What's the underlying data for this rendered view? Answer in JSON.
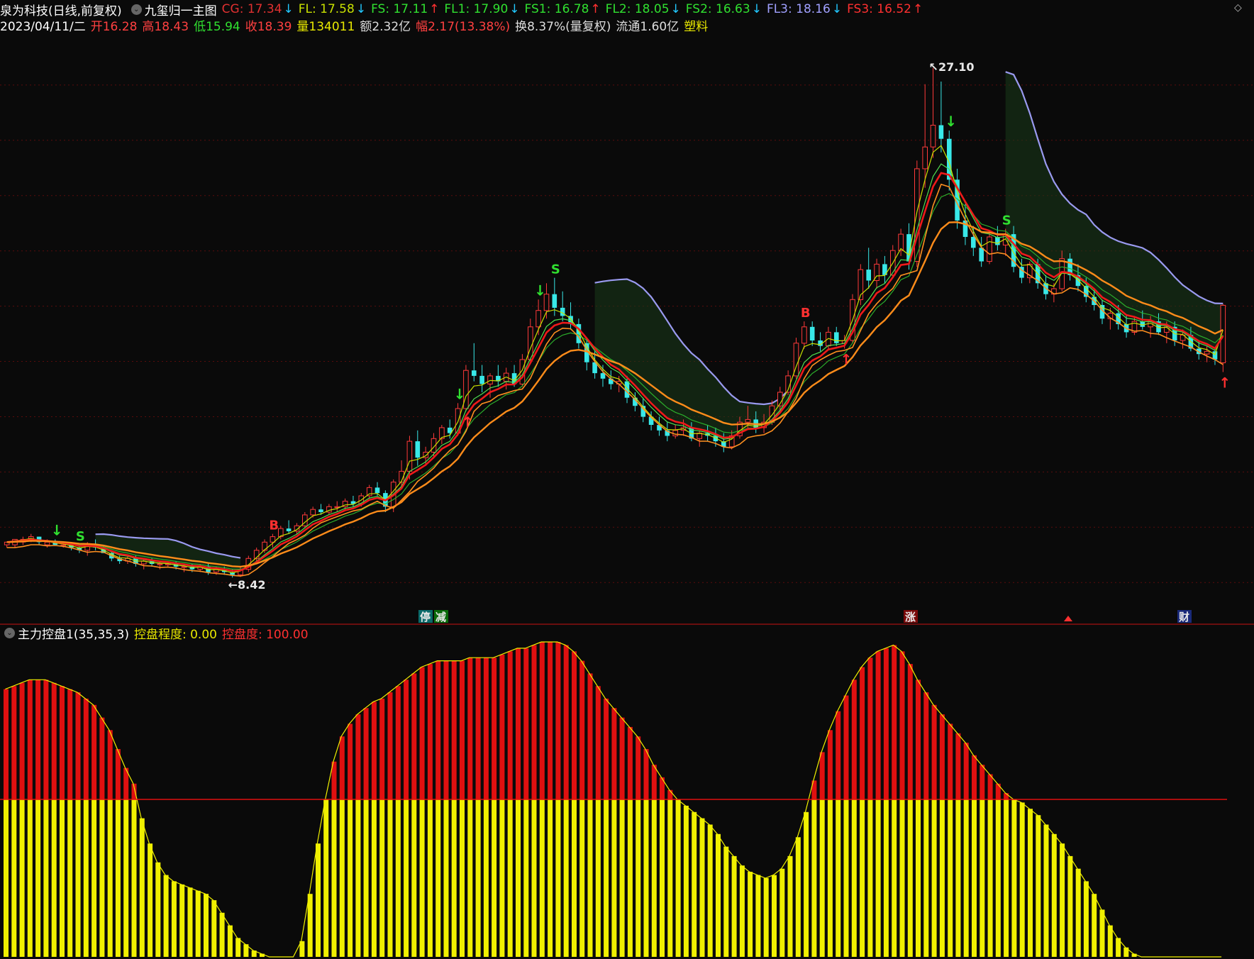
{
  "header": {
    "stock": "泉为科技(日线,前复权)",
    "template": "九玺归一主图",
    "indicators": [
      {
        "label": "CG: 17.34",
        "arrow": "↓",
        "color": "#e03030",
        "arrowColor": "#22c8ff"
      },
      {
        "label": "FL: 17.58",
        "arrow": "↓",
        "color": "#c8e000",
        "arrowColor": "#22c8ff"
      },
      {
        "label": "FS: 17.11",
        "arrow": "↑",
        "color": "#30e030",
        "arrowColor": "#ff3030"
      },
      {
        "label": "FL1: 17.90",
        "arrow": "↓",
        "color": "#30e030",
        "arrowColor": "#22c8ff"
      },
      {
        "label": "FS1: 16.78",
        "arrow": "↑",
        "color": "#30e030",
        "arrowColor": "#ff3030"
      },
      {
        "label": "FL2: 18.05",
        "arrow": "↓",
        "color": "#30e030",
        "arrowColor": "#22c8ff"
      },
      {
        "label": "FS2: 16.63",
        "arrow": "↓",
        "color": "#30e030",
        "arrowColor": "#22c8ff"
      },
      {
        "label": "FL3: 18.16",
        "arrow": "↓",
        "color": "#a0a0ff",
        "arrowColor": "#22c8ff"
      },
      {
        "label": "FS3: 16.52",
        "arrow": "↑",
        "color": "#ff3030",
        "arrowColor": "#ff3030"
      }
    ],
    "date": "2023/04/11/二",
    "stats": [
      {
        "k": "开",
        "v": "16.28",
        "kc": "#ff4040",
        "vc": "#ff4040"
      },
      {
        "k": "高",
        "v": "18.43",
        "kc": "#ff4040",
        "vc": "#ff4040"
      },
      {
        "k": "低",
        "v": "15.94",
        "kc": "#30e030",
        "vc": "#30e030"
      },
      {
        "k": "收",
        "v": "18.39",
        "kc": "#ff4040",
        "vc": "#ff4040"
      },
      {
        "k": "量",
        "v": "134011",
        "kc": "#e8e800",
        "vc": "#e8e800"
      },
      {
        "k": "额",
        "v": "2.32亿",
        "kc": "#ddd",
        "vc": "#ddd"
      },
      {
        "k": "幅",
        "v": "2.17(13.38%)",
        "kc": "#ff4040",
        "vc": "#ff4040"
      },
      {
        "k": "换",
        "v": "8.37%(量复权)",
        "kc": "#ddd",
        "vc": "#ddd"
      },
      {
        "k": "流通",
        "v": "1.60亿",
        "kc": "#ddd",
        "vc": "#ddd"
      },
      {
        "k": "",
        "v": "塑料",
        "kc": "#e8e800",
        "vc": "#e8e800"
      }
    ]
  },
  "sub": {
    "title": "主力控盘1(35,35,3)",
    "l1": "控盘程度: 0.00",
    "l2": "控盘度: 100.00"
  },
  "markers": {
    "b": "B",
    "s": "S",
    "ting": "停",
    "jian": "减",
    "zhang": "涨",
    "cai": "财"
  },
  "chart_data": [
    {
      "type": "candlestick",
      "ylim": [
        7.0,
        28.5
      ],
      "max_label": "27.10",
      "min_label": "8.42",
      "candles": [
        [
          9.6,
          9.7,
          9.5,
          9.7
        ],
        [
          9.6,
          9.8,
          9.5,
          9.8
        ],
        [
          9.7,
          9.9,
          9.6,
          9.8
        ],
        [
          9.8,
          10.0,
          9.7,
          9.9
        ],
        [
          9.9,
          9.9,
          9.6,
          9.7
        ],
        [
          9.6,
          9.8,
          9.5,
          9.7
        ],
        [
          9.7,
          9.8,
          9.6,
          9.6
        ],
        [
          9.6,
          9.7,
          9.5,
          9.6
        ],
        [
          9.6,
          9.7,
          9.4,
          9.5
        ],
        [
          9.5,
          9.6,
          9.3,
          9.4
        ],
        [
          9.4,
          9.7,
          9.2,
          9.6
        ],
        [
          9.6,
          9.8,
          9.4,
          9.5
        ],
        [
          9.5,
          9.6,
          9.3,
          9.3
        ],
        [
          9.3,
          9.4,
          9.0,
          9.1
        ],
        [
          9.1,
          9.2,
          8.9,
          9.0
        ],
        [
          9.0,
          9.2,
          8.9,
          9.1
        ],
        [
          9.1,
          9.2,
          8.8,
          8.9
        ],
        [
          8.9,
          9.1,
          8.7,
          9.0
        ],
        [
          9.0,
          9.1,
          8.8,
          8.9
        ],
        [
          8.9,
          9.0,
          8.7,
          8.9
        ],
        [
          8.9,
          9.0,
          8.8,
          8.9
        ],
        [
          8.9,
          9.0,
          8.7,
          8.8
        ],
        [
          8.8,
          8.9,
          8.6,
          8.8
        ],
        [
          8.8,
          8.9,
          8.6,
          8.7
        ],
        [
          8.7,
          8.9,
          8.6,
          8.8
        ],
        [
          8.8,
          8.9,
          8.5,
          8.6
        ],
        [
          8.6,
          8.8,
          8.5,
          8.7
        ],
        [
          8.7,
          8.8,
          8.5,
          8.6
        ],
        [
          8.6,
          8.7,
          8.4,
          8.5
        ],
        [
          8.5,
          8.8,
          8.42,
          8.7
        ],
        [
          8.7,
          9.2,
          8.6,
          9.1
        ],
        [
          9.1,
          9.5,
          9.0,
          9.4
        ],
        [
          9.4,
          9.8,
          9.3,
          9.7
        ],
        [
          9.7,
          10.0,
          9.5,
          9.9
        ],
        [
          9.9,
          10.3,
          9.8,
          10.2
        ],
        [
          10.2,
          10.5,
          10.0,
          10.1
        ],
        [
          10.1,
          10.4,
          10.0,
          10.3
        ],
        [
          10.3,
          10.8,
          10.2,
          10.7
        ],
        [
          10.7,
          11.0,
          10.6,
          10.9
        ],
        [
          10.9,
          11.1,
          10.7,
          10.8
        ],
        [
          10.8,
          11.1,
          10.7,
          11.0
        ],
        [
          11.0,
          11.2,
          10.8,
          11.0
        ],
        [
          11.0,
          11.3,
          10.9,
          11.2
        ],
        [
          11.2,
          11.4,
          11.0,
          11.1
        ],
        [
          11.1,
          11.5,
          11.0,
          11.4
        ],
        [
          11.4,
          11.8,
          11.3,
          11.7
        ],
        [
          11.7,
          11.9,
          11.4,
          11.5
        ],
        [
          11.5,
          11.6,
          10.8,
          11.0
        ],
        [
          11.0,
          12.0,
          10.8,
          11.9
        ],
        [
          11.9,
          12.7,
          11.7,
          12.3
        ],
        [
          12.3,
          13.6,
          12.0,
          13.4
        ],
        [
          13.4,
          13.8,
          12.5,
          12.8
        ],
        [
          12.8,
          13.2,
          12.5,
          13.0
        ],
        [
          13.0,
          13.7,
          12.8,
          13.5
        ],
        [
          13.5,
          14.0,
          13.3,
          13.9
        ],
        [
          13.9,
          14.2,
          13.5,
          13.7
        ],
        [
          13.7,
          14.8,
          13.6,
          14.6
        ],
        [
          14.6,
          16.2,
          14.5,
          16.0
        ],
        [
          16.0,
          17.0,
          15.6,
          15.8
        ],
        [
          15.8,
          16.2,
          15.2,
          15.5
        ],
        [
          15.5,
          15.9,
          15.0,
          15.8
        ],
        [
          15.8,
          16.2,
          15.4,
          15.6
        ],
        [
          15.6,
          16.1,
          15.3,
          15.9
        ],
        [
          15.9,
          16.2,
          15.4,
          15.5
        ],
        [
          15.5,
          16.6,
          15.4,
          16.4
        ],
        [
          16.4,
          17.9,
          16.3,
          17.6
        ],
        [
          17.6,
          18.6,
          17.3,
          18.2
        ],
        [
          18.2,
          19.2,
          17.9,
          18.8
        ],
        [
          18.8,
          19.4,
          18.0,
          18.3
        ],
        [
          18.3,
          18.9,
          17.8,
          18.0
        ],
        [
          18.0,
          18.5,
          17.5,
          17.7
        ],
        [
          17.7,
          17.9,
          16.8,
          17.0
        ],
        [
          17.0,
          17.2,
          16.0,
          16.3
        ],
        [
          16.3,
          16.7,
          15.7,
          15.9
        ],
        [
          15.9,
          16.2,
          15.4,
          15.7
        ],
        [
          15.7,
          16.0,
          15.3,
          15.5
        ],
        [
          15.5,
          15.8,
          15.2,
          15.6
        ],
        [
          15.6,
          15.8,
          14.8,
          15.0
        ],
        [
          15.0,
          15.2,
          14.5,
          14.7
        ],
        [
          14.7,
          15.0,
          14.1,
          14.3
        ],
        [
          14.3,
          14.5,
          13.8,
          14.0
        ],
        [
          14.0,
          14.3,
          13.6,
          13.8
        ],
        [
          13.8,
          14.1,
          13.4,
          13.6
        ],
        [
          13.6,
          14.0,
          13.5,
          13.8
        ],
        [
          13.8,
          14.2,
          13.6,
          13.9
        ],
        [
          13.9,
          14.1,
          13.4,
          13.5
        ],
        [
          13.5,
          13.8,
          13.2,
          13.7
        ],
        [
          13.7,
          14.0,
          13.4,
          13.6
        ],
        [
          13.6,
          13.9,
          13.2,
          13.4
        ],
        [
          13.4,
          13.7,
          13.0,
          13.2
        ],
        [
          13.2,
          13.8,
          13.1,
          13.6
        ],
        [
          13.6,
          14.3,
          13.5,
          14.1
        ],
        [
          14.1,
          14.7,
          13.9,
          14.2
        ],
        [
          14.2,
          14.5,
          13.7,
          13.9
        ],
        [
          13.9,
          14.4,
          13.7,
          14.1
        ],
        [
          14.1,
          14.9,
          14.0,
          14.7
        ],
        [
          14.7,
          15.4,
          14.5,
          15.2
        ],
        [
          15.2,
          16.0,
          15.1,
          15.8
        ],
        [
          15.8,
          17.2,
          15.7,
          17.0
        ],
        [
          17.0,
          17.8,
          16.8,
          17.6
        ],
        [
          17.6,
          17.8,
          16.9,
          17.1
        ],
        [
          17.1,
          17.4,
          16.7,
          16.9
        ],
        [
          16.9,
          17.6,
          16.8,
          17.4
        ],
        [
          17.4,
          17.6,
          16.9,
          17.0
        ],
        [
          17.0,
          17.3,
          16.8,
          17.1
        ],
        [
          17.1,
          18.8,
          17.0,
          18.6
        ],
        [
          18.6,
          19.9,
          18.4,
          19.7
        ],
        [
          19.7,
          20.5,
          19.0,
          19.3
        ],
        [
          19.3,
          20.1,
          19.0,
          19.9
        ],
        [
          19.9,
          20.2,
          19.2,
          19.5
        ],
        [
          19.5,
          20.6,
          19.4,
          20.4
        ],
        [
          20.4,
          21.2,
          20.2,
          21.0
        ],
        [
          21.0,
          21.4,
          19.7,
          20.0
        ],
        [
          20.0,
          23.7,
          19.8,
          23.4
        ],
        [
          23.4,
          26.5,
          22.7,
          24.2
        ],
        [
          24.2,
          27.1,
          23.8,
          25.0
        ],
        [
          25.0,
          26.6,
          24.0,
          24.5
        ],
        [
          24.5,
          24.8,
          22.6,
          23.0
        ],
        [
          23.0,
          23.4,
          21.2,
          21.5
        ],
        [
          21.5,
          22.1,
          20.6,
          20.9
        ],
        [
          20.9,
          21.3,
          20.2,
          20.5
        ],
        [
          20.5,
          20.9,
          19.8,
          20.0
        ],
        [
          20.0,
          21.1,
          19.9,
          20.9
        ],
        [
          20.9,
          21.3,
          20.4,
          20.6
        ],
        [
          20.6,
          21.2,
          20.2,
          21.0
        ],
        [
          21.0,
          21.3,
          19.6,
          19.8
        ],
        [
          19.8,
          20.1,
          19.2,
          19.4
        ],
        [
          19.4,
          20.0,
          19.2,
          19.9
        ],
        [
          19.9,
          20.1,
          19.0,
          19.2
        ],
        [
          19.2,
          19.5,
          18.6,
          18.8
        ],
        [
          18.8,
          19.2,
          18.5,
          19.0
        ],
        [
          19.0,
          20.4,
          18.9,
          20.1
        ],
        [
          20.1,
          20.3,
          19.3,
          19.5
        ],
        [
          19.5,
          19.9,
          18.9,
          19.1
        ],
        [
          19.1,
          19.4,
          18.5,
          18.7
        ],
        [
          18.7,
          19.0,
          18.2,
          18.4
        ],
        [
          18.4,
          18.6,
          17.7,
          17.9
        ],
        [
          17.9,
          18.3,
          17.5,
          18.1
        ],
        [
          18.1,
          18.4,
          17.5,
          17.7
        ],
        [
          17.7,
          18.0,
          17.2,
          17.4
        ],
        [
          17.4,
          18.0,
          17.3,
          17.8
        ],
        [
          17.8,
          18.2,
          17.5,
          17.6
        ],
        [
          17.6,
          18.0,
          17.2,
          17.8
        ],
        [
          17.8,
          18.1,
          17.3,
          17.4
        ],
        [
          17.4,
          17.8,
          17.0,
          17.6
        ],
        [
          17.6,
          17.8,
          16.9,
          17.1
        ],
        [
          17.1,
          17.5,
          16.8,
          17.3
        ],
        [
          17.3,
          17.6,
          16.7,
          16.8
        ],
        [
          16.8,
          17.1,
          16.4,
          16.6
        ],
        [
          16.6,
          16.9,
          16.3,
          16.7
        ],
        [
          16.7,
          16.8,
          16.2,
          16.4
        ],
        [
          16.28,
          18.43,
          15.94,
          18.39
        ]
      ]
    },
    {
      "type": "bar",
      "name": "主力控盘1",
      "ylim": [
        0,
        100
      ],
      "threshold": 50,
      "values": [
        85,
        86,
        87,
        88,
        88,
        88,
        87,
        86,
        85,
        84,
        82,
        80,
        76,
        72,
        66,
        60,
        55,
        44,
        36,
        30,
        26,
        24,
        23,
        22,
        21,
        20,
        18,
        14,
        10,
        6,
        4,
        2,
        1,
        0,
        0,
        0,
        0,
        5,
        20,
        36,
        50,
        62,
        70,
        74,
        77,
        79,
        81,
        82,
        84,
        86,
        88,
        90,
        92,
        93,
        94,
        94,
        94,
        94,
        95,
        95,
        95,
        95,
        96,
        97,
        98,
        98,
        99,
        100,
        100,
        100,
        99,
        97,
        94,
        90,
        86,
        82,
        79,
        76,
        73,
        70,
        66,
        61,
        57,
        53,
        50,
        48,
        46,
        44,
        42,
        39,
        35,
        32,
        29,
        27,
        26,
        25,
        26,
        28,
        32,
        38,
        46,
        56,
        65,
        72,
        78,
        83,
        88,
        92,
        95,
        97,
        98,
        99,
        97,
        93,
        88,
        84,
        80,
        77,
        74,
        71,
        68,
        64,
        61,
        58,
        55,
        52,
        50,
        49,
        47,
        45,
        42,
        39,
        36,
        32,
        28,
        24,
        20,
        15,
        10,
        6,
        3,
        1,
        0,
        0,
        0,
        0,
        0,
        0,
        0,
        0,
        0,
        0,
        0
      ]
    }
  ]
}
